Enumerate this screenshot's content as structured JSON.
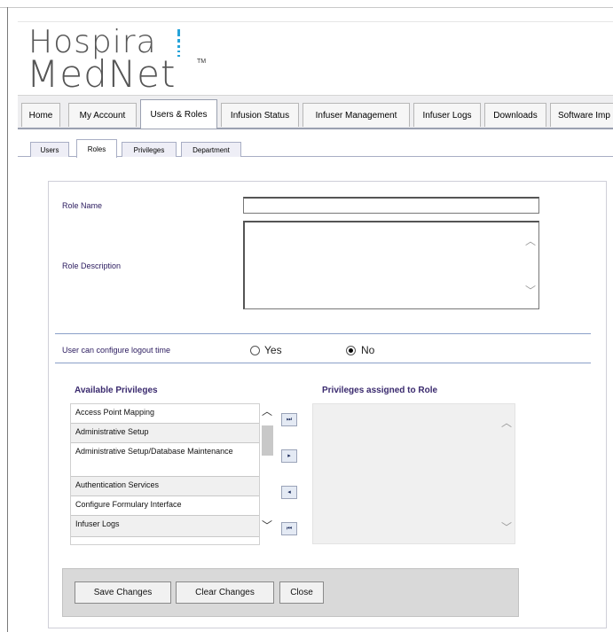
{
  "logo": {
    "line1": "Hospira",
    "line2": "MedNet",
    "tm": "TM",
    "accent_color": "#26a3d9"
  },
  "main_tabs": [
    {
      "label": "Home"
    },
    {
      "label": "My Account"
    },
    {
      "label": "Users & Roles",
      "active": true
    },
    {
      "label": "Infusion Status"
    },
    {
      "label": "Infuser Management"
    },
    {
      "label": "Infuser Logs"
    },
    {
      "label": "Downloads"
    },
    {
      "label": "Software Imp"
    }
  ],
  "sub_tabs": [
    {
      "label": "Users"
    },
    {
      "label": "Roles",
      "active": true
    },
    {
      "label": "Privileges"
    },
    {
      "label": "Department"
    }
  ],
  "form": {
    "role_name_label": "Role Name",
    "role_name_value": "",
    "role_description_label": "Role Description",
    "role_description_value": "",
    "logout_label": "User can configure logout time",
    "yes_label": "Yes",
    "no_label": "No",
    "logout_selected": "No"
  },
  "privileges": {
    "available_header": "Available Privileges",
    "assigned_header": "Privileges assigned to Role",
    "available": [
      "Access Point Mapping",
      "Administrative Setup",
      "Administrative Setup/Database Maintenance",
      "Authentication Services",
      "Configure Formulary Interface",
      "Infuser Logs"
    ],
    "assigned": [],
    "move_all_right": "⏭",
    "move_right": "▸",
    "move_left": "◂",
    "move_all_left": "⏮"
  },
  "buttons": {
    "save": "Save Changes",
    "clear": "Clear Changes",
    "close": "Close"
  }
}
